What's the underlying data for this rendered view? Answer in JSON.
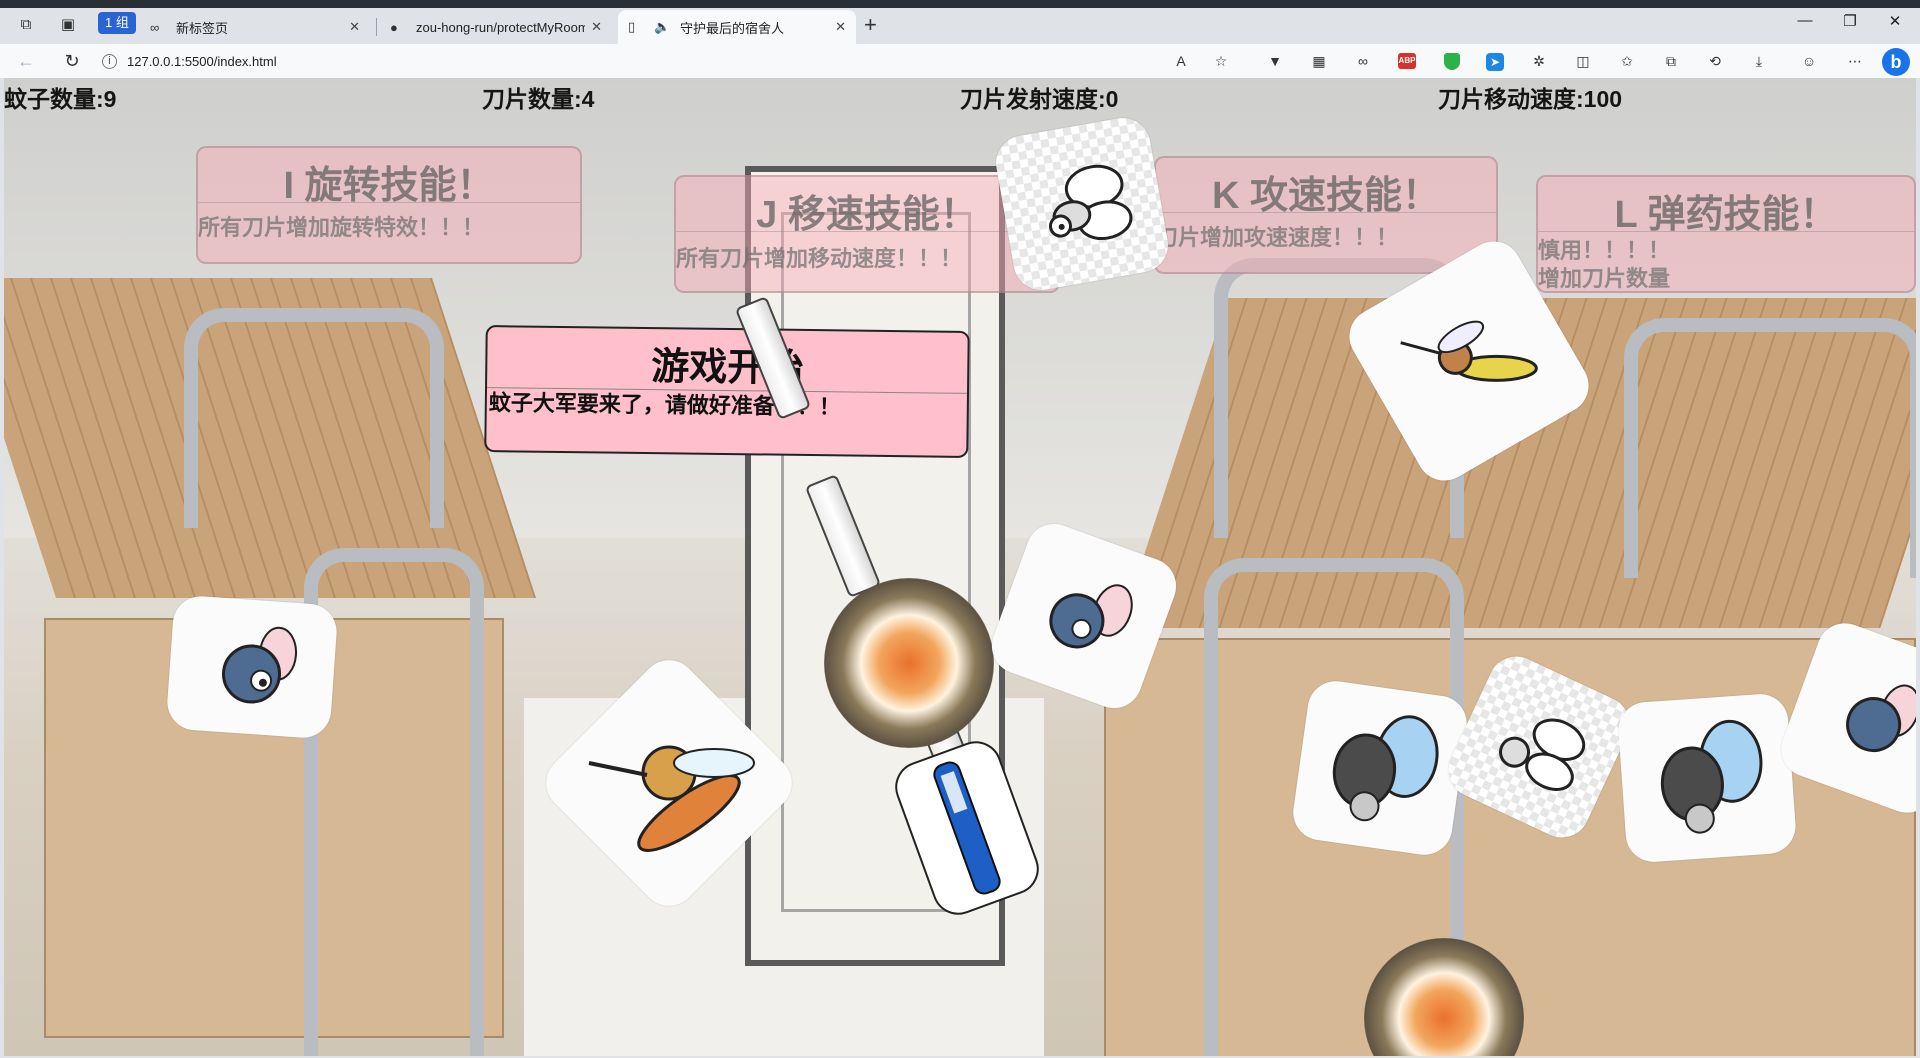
{
  "browser": {
    "group_badge": "1 组",
    "tabs": [
      {
        "title": "新标签页",
        "icon": "infinity-icon",
        "active": false
      },
      {
        "title": "zou-hong-run/protectMyRoom",
        "icon": "github-icon",
        "active": false
      },
      {
        "title": "守护最后的宿舍人",
        "icon": "page-icon",
        "active": true
      }
    ],
    "url": "127.0.0.1:5500/index.html",
    "ext_abp": "ABP"
  },
  "hud": {
    "mosquito_count": "蚊子数量:9",
    "blade_count": "刀片数量:4",
    "fire_speed": "刀片发射速度:0",
    "move_speed": "刀片移动速度:100"
  },
  "skills": [
    {
      "title": "I 旋转技能！",
      "desc": [
        "所有刀片增加旋转特效！！！"
      ]
    },
    {
      "title": "J 移速技能！",
      "desc": [
        "所有刀片增加移动速度！！！"
      ]
    },
    {
      "title": "K 攻速技能！",
      "desc": [
        "刀片增加攻速速度！！！"
      ]
    },
    {
      "title": "L 弹药技能！",
      "desc": [
        "慎用！！！！",
        "增加刀片数量"
      ]
    }
  ],
  "start": {
    "title": "游戏开始",
    "desc": "蚊子大军要来了，请做好准备！！！"
  },
  "colors": {
    "card_pink": "#ffbfcb",
    "skill_pink": "#f9aab9",
    "tab_active": "#f7f9fb",
    "chrome": "#dfe3e8"
  }
}
